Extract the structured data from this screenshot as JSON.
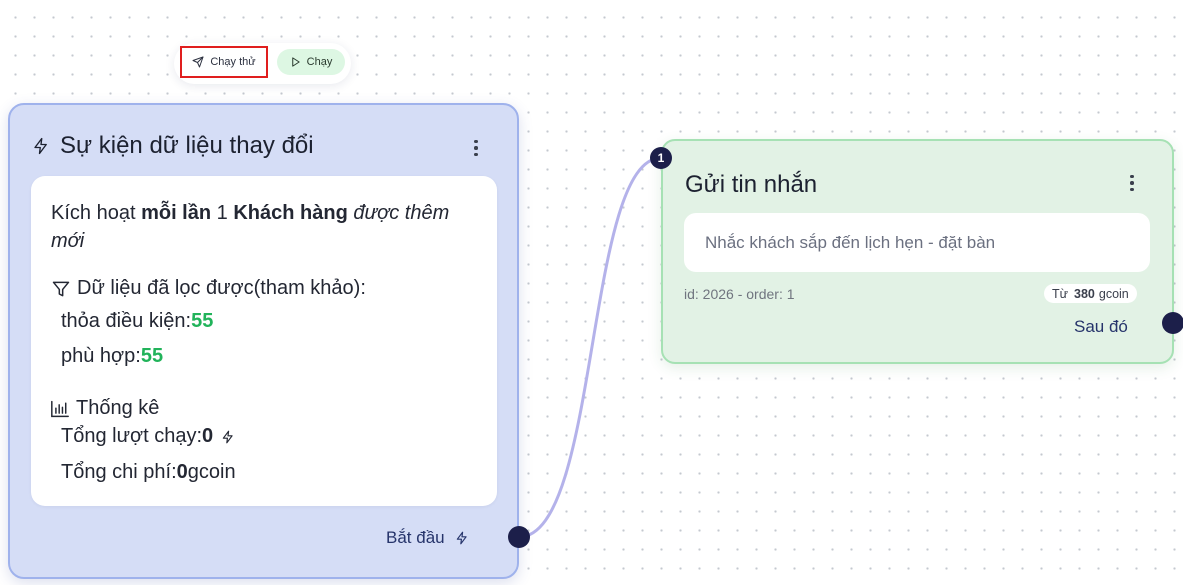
{
  "colors": {
    "trigger_bg": "#d5ddf6",
    "trigger_border": "#9fb2ec",
    "action_bg": "#e2f2e5",
    "action_border": "#a6e1b4",
    "connector": "#b4b2ea",
    "handle": "#1c1f4a",
    "highlight": "#e01e1e",
    "success": "#21b35a"
  },
  "toolbar": {
    "test_run_label": "Chạy thử",
    "test_run_icon": "send-icon",
    "run_label": "Chạy",
    "run_icon": "play-icon"
  },
  "trigger": {
    "icon": "lightning-icon",
    "title": "Sự kiện dữ liệu thay đổi",
    "menu_icon": "more-vertical-icon",
    "description": {
      "prefix": "Kích hoạt ",
      "frequency": "mỗi lần",
      "count": " 1 ",
      "entity": "Khách hàng",
      "event": " được thêm mới"
    },
    "filter": {
      "icon": "filter-icon",
      "heading": "Dữ liệu đã lọc được(tham khảo):",
      "condition_label": "thỏa điều kiện: ",
      "condition_value": "55",
      "match_label": "phù hợp: ",
      "match_value": "55"
    },
    "stats": {
      "icon": "bar-chart-icon",
      "heading": "Thống kê",
      "runs_label": "Tổng lượt chạy: ",
      "runs_value": "0",
      "runs_icon": "lightning-icon",
      "cost_label": "Tổng chi phí: ",
      "cost_value": "0",
      "cost_unit": " gcoin"
    },
    "start_label": "Bắt đầu",
    "start_icon": "lightning-icon"
  },
  "action": {
    "badge": "1",
    "title": "Gửi tin nhắn",
    "menu_icon": "more-vertical-icon",
    "message": "Nhắc khách sắp đến lịch hẹn - đặt bàn",
    "meta": "id: 2026 - order: 1",
    "cost_prefix": "Từ",
    "cost_value": "380",
    "cost_unit": "gcoin",
    "next_label": "Sau đó"
  }
}
